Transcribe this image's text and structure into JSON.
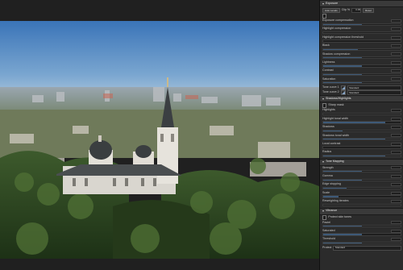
{
  "colors": {
    "panel_bg": "#2b2b2b",
    "section_bg": "#3a3a3a",
    "slider_fill": "#3e5a78",
    "sky_top": "#3a74b8",
    "sky_bottom": "#8eb3d6"
  },
  "exposure": {
    "title": "Exposure",
    "auto_levels": "Auto Levels",
    "clip_label": "Clip %",
    "clip_value": "0.05",
    "reset": "Reset",
    "highlight_recon": "",
    "rows": [
      {
        "label": "Exposure compensation",
        "value": "",
        "level": 0.5
      },
      {
        "label": "Highlight compression",
        "value": "",
        "level": 0.0
      },
      {
        "label": "Highlight compression threshold",
        "value": "",
        "level": 0.0
      },
      {
        "label": "Black",
        "value": "",
        "level": 0.45
      },
      {
        "label": "Shadow compression",
        "value": "",
        "level": 0.5
      },
      {
        "label": "Lightness",
        "value": "",
        "level": 0.5
      },
      {
        "label": "Contrast",
        "value": "",
        "level": 0.5
      },
      {
        "label": "Saturation",
        "value": "",
        "level": 0.5
      }
    ],
    "curve1_label": "Tone curve 1",
    "curve1_mode": "Standard",
    "curve2_label": "Tone curve 2",
    "curve2_mode": "Standard"
  },
  "shadows_highlights": {
    "title": "Shadows/Highlights",
    "sharp_mask": "Sharp mask",
    "rows": [
      {
        "label": "Highlights",
        "value": "",
        "level": 0.0
      },
      {
        "label": "Highlight tonal width",
        "value": "",
        "level": 0.8
      },
      {
        "label": "Shadows",
        "value": "",
        "level": 0.25
      },
      {
        "label": "Shadows tonal width",
        "value": "",
        "level": 0.8
      },
      {
        "label": "Local contrast",
        "value": "",
        "level": 0.0
      },
      {
        "label": "Radius",
        "value": "",
        "level": 0.8
      }
    ]
  },
  "tone_mapping": {
    "title": "Tone Mapping",
    "rows": [
      {
        "label": "Strength",
        "value": "",
        "level": 0.5
      },
      {
        "label": "Gamma",
        "value": "",
        "level": 0.5
      },
      {
        "label": "Edge stopping",
        "value": "",
        "level": 0.3
      },
      {
        "label": "Scale",
        "value": "",
        "level": 0.2
      },
      {
        "label": "Reweighting iterates",
        "value": "",
        "level": 0.0
      }
    ]
  },
  "vibrance": {
    "title": "Vibrance",
    "skin_tone_label": "Protect skin tones",
    "rows": [
      {
        "label": "Pastel",
        "value": "",
        "level": 0.5
      },
      {
        "label": "Saturated",
        "value": "",
        "level": 0.5
      },
      {
        "label": "Threshold",
        "value": "",
        "level": 0.5
      }
    ],
    "protect_label": "Protect",
    "protect_value": "Standard"
  }
}
